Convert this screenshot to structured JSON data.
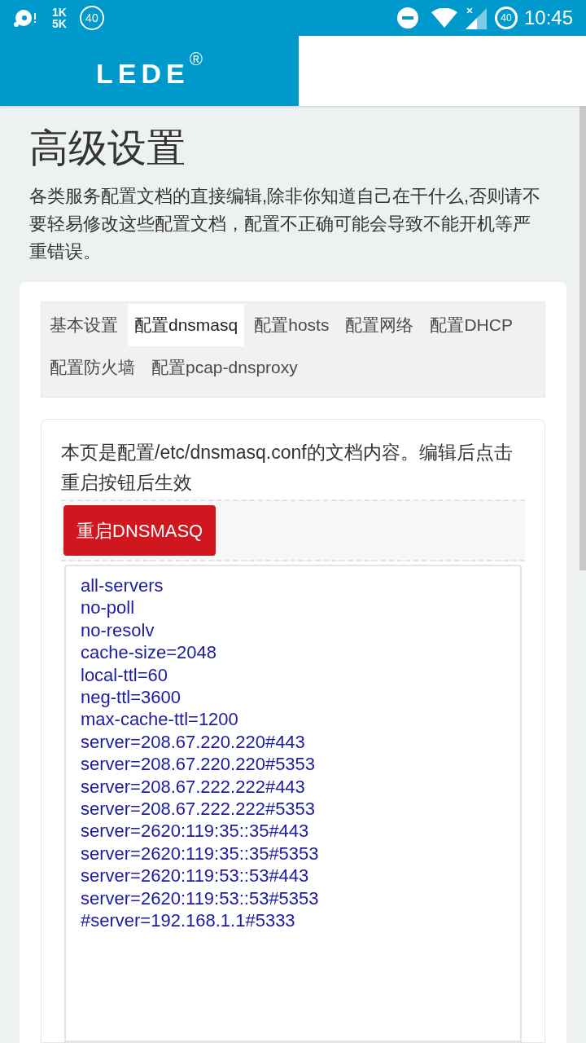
{
  "status_bar": {
    "traffic_up": "1K",
    "traffic_down": "5K",
    "left_badge": "40",
    "right_badge": "40",
    "time": "10:45"
  },
  "header": {
    "logo": "LEDE",
    "logo_mark": "®"
  },
  "page": {
    "title": "高级设置",
    "description": "各类服务配置文档的直接编辑,除非你知道自己在干什么,否则请不要轻易修改这些配置文档，配置不正确可能会导致不能开机等严重错误。"
  },
  "tabs": [
    {
      "label": "基本设置",
      "selected": false
    },
    {
      "label": "配置dnsmasq",
      "selected": true
    },
    {
      "label": "配置hosts",
      "selected": false
    },
    {
      "label": "配置网络",
      "selected": false
    },
    {
      "label": "配置DHCP",
      "selected": false
    },
    {
      "label": "配置防火墙",
      "selected": false
    },
    {
      "label": "配置pcap-dnsproxy",
      "selected": false
    }
  ],
  "section": {
    "note": "本页是配置/etc/dnsmasq.conf的文档内容。编辑后点击重启按钮后生效",
    "restart_button": "重启DNSMASQ"
  },
  "editor": {
    "lines": [
      "all-servers",
      "no-poll",
      "no-resolv",
      "cache-size=2048",
      "local-ttl=60",
      "neg-ttl=3600",
      "max-cache-ttl=1200",
      "server=208.67.220.220#443",
      "server=208.67.220.220#5353",
      "server=208.67.222.222#443",
      "server=208.67.222.222#5353",
      "server=2620:119:35::35#443",
      "server=2620:119:35::35#5353",
      "server=2620:119:53::53#443",
      "server=2620:119:53::53#5353",
      "#server=192.168.1.1#5333"
    ]
  }
}
